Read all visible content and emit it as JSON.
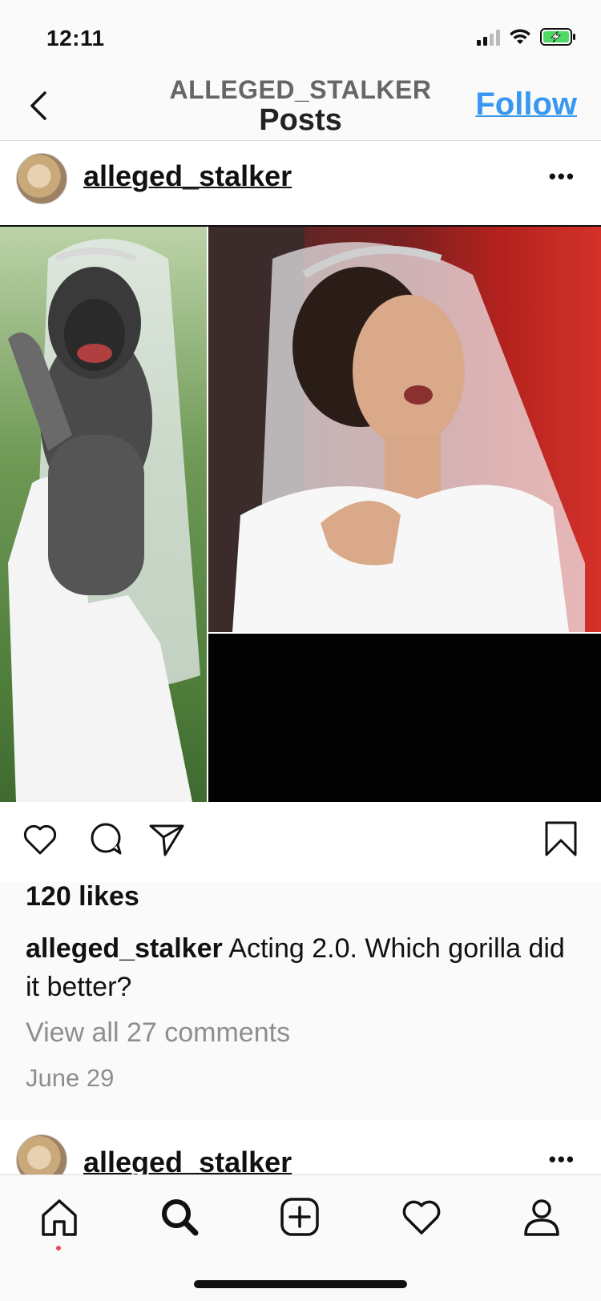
{
  "status_bar": {
    "time": "12:11"
  },
  "header": {
    "username": "ALLEGED_STALKER",
    "subtitle": "Posts",
    "follow_label": "Follow"
  },
  "post": {
    "username": "alleged_stalker",
    "more_label": "•••",
    "likes": "120 likes",
    "caption_user": "alleged_stalker",
    "caption_text": " Acting 2.0. Which gorilla did it better?",
    "comments_link": "View all 27 comments",
    "date": "June 29"
  },
  "next_post": {
    "username": "alleged_stalker",
    "more_label": "•••"
  },
  "tabbar": {
    "items": [
      "home-icon",
      "search-icon",
      "new-post-icon",
      "activity-heart-icon",
      "profile-icon"
    ]
  },
  "colors": {
    "accent": "#3897f0",
    "secondary_text": "#8e8e8e",
    "notification_dot": "#ed4956"
  }
}
